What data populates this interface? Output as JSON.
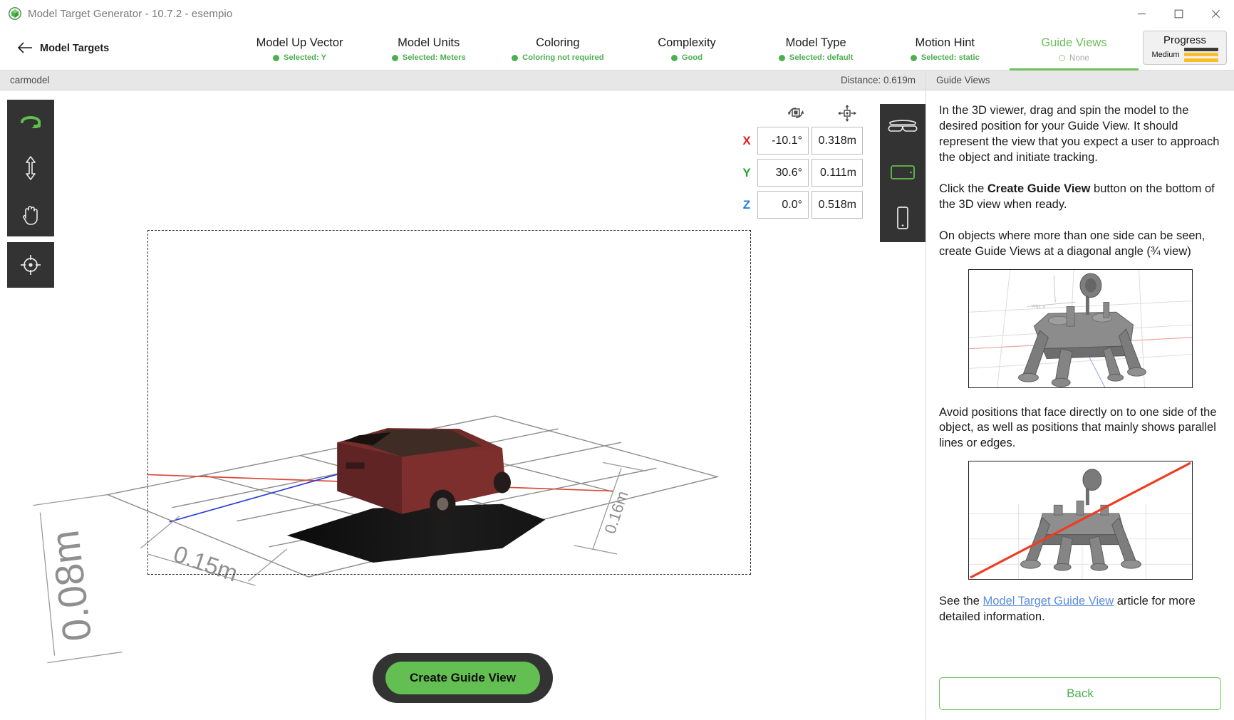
{
  "window": {
    "title": "Model Target Generator - 10.7.2 - esempio",
    "app_icon": "cube-icon",
    "minimize_label": "Minimize",
    "maximize_label": "Maximize",
    "close_label": "Close"
  },
  "nav": {
    "back_label": "Model Targets",
    "back_icon": "arrow-left-icon",
    "steps": [
      {
        "title": "Model Up Vector",
        "status": "Selected: Y",
        "state": "done"
      },
      {
        "title": "Model Units",
        "status": "Selected: Meters",
        "state": "done"
      },
      {
        "title": "Coloring",
        "status": "Coloring not required",
        "state": "done"
      },
      {
        "title": "Complexity",
        "status": "Good",
        "state": "done"
      },
      {
        "title": "Model Type",
        "status": "Selected: default",
        "state": "done"
      },
      {
        "title": "Motion Hint",
        "status": "Selected: static",
        "state": "done"
      },
      {
        "title": "Guide Views",
        "status": "None",
        "state": "active"
      }
    ],
    "progress": {
      "title": "Progress",
      "level_label": "Medium",
      "bars": [
        "#3b3b3b",
        "#fbbe28",
        "#fbbe28"
      ]
    },
    "active_color": "#6cbf59",
    "done_color": "#4caf50"
  },
  "viewer": {
    "header": {
      "model_name": "carmodel",
      "distance_label": "Distance:  0.619m"
    },
    "tools": [
      {
        "name": "rotate-tool",
        "label": "Rotate",
        "active": true
      },
      {
        "name": "zoom-tool",
        "label": "Zoom",
        "active": false
      },
      {
        "name": "pan-tool",
        "label": "Pan",
        "active": false
      },
      {
        "name": "recenter-tool",
        "label": "Recenter",
        "active": false
      }
    ],
    "transform": {
      "rotation_icon": "rotate-object-icon",
      "translate_icon": "move-object-icon",
      "rows": [
        {
          "axis": "X",
          "rotation": "-10.1°",
          "translation": "0.318m",
          "color": "#e02020"
        },
        {
          "axis": "Y",
          "rotation": "30.6°",
          "translation": "0.111m",
          "color": "#24a22a"
        },
        {
          "axis": "Z",
          "rotation": "0.0°",
          "translation": "0.518m",
          "color": "#1e7fe0"
        }
      ]
    },
    "devices": [
      {
        "name": "ar-glasses-icon",
        "label": "AR Glasses",
        "active": false
      },
      {
        "name": "tablet-icon",
        "label": "Tablet",
        "active": true
      },
      {
        "name": "phone-icon",
        "label": "Phone",
        "active": false
      }
    ],
    "dimensions": {
      "left": "0.08m",
      "front": "0.15m",
      "right": "0.16m"
    },
    "create_button": "Create Guide View"
  },
  "panel": {
    "header": "Guide Views",
    "paragraph1": "In the 3D viewer, drag and spin the model to the desired position for your Guide View. It should represent the view that you expect a user to approach the object and initiate tracking.",
    "paragraph2_pre": "Click the ",
    "paragraph2_bold": "Create Guide View",
    "paragraph2_post": " button on the bottom of the 3D view when ready.",
    "paragraph3": "On objects where more than one side can be seen, create Guide Views at a diagonal angle (¾ view)",
    "paragraph4": "Avoid positions that face directly on to one side of the object, as well as positions that mainly shows parallel lines or edges.",
    "paragraph5_pre": "See the ",
    "paragraph5_link": "Model Target Guide View",
    "paragraph5_post": " article for more detailed information.",
    "thumb1_alt": "lunar-lander-diagonal-view-example",
    "thumb2_alt": "lunar-lander-front-view-bad-example",
    "back_button": "Back"
  }
}
